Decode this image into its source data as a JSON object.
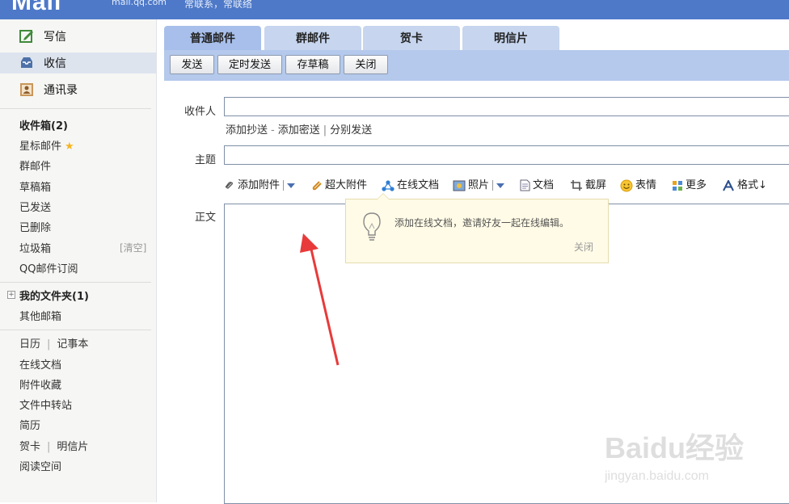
{
  "header": {
    "logo": "Mail",
    "domain": "mail.qq.com",
    "slogan": "常联系，常联络"
  },
  "sidebar": {
    "main_nav": [
      {
        "label": "写信",
        "icon": "compose-icon"
      },
      {
        "label": "收信",
        "icon": "inbox-icon"
      },
      {
        "label": "通讯录",
        "icon": "contacts-icon"
      }
    ],
    "folders": {
      "inbox": "收件箱(2)",
      "starred": "星标邮件",
      "group": "群邮件",
      "drafts": "草稿箱",
      "sent": "已发送",
      "deleted": "已删除",
      "trash": "垃圾箱",
      "trash_clear": "[清空]",
      "subscriptions": "QQ邮件订阅"
    },
    "my_folders": "我的文件夹(1)",
    "other_mailbox": "其他邮箱",
    "apps": {
      "calendar": "日历",
      "notepad": "记事本",
      "online_docs": "在线文档",
      "attachment_fav": "附件收藏",
      "file_transfer": "文件中转站",
      "resume": "简历",
      "greeting": "贺卡",
      "postcard": "明信片",
      "reading": "阅读空间",
      "separator": "|"
    }
  },
  "compose": {
    "tabs": [
      "普通邮件",
      "群邮件",
      "贺卡",
      "明信片"
    ],
    "toolbar": {
      "send": "发送",
      "scheduled_send": "定时发送",
      "save_draft": "存草稿",
      "close": "关闭"
    },
    "recipient_label": "收件人",
    "add_cc": "添加抄送",
    "add_bcc": "添加密送",
    "separate_send": "分别发送",
    "link_dash": "-",
    "link_pipe": "|",
    "subject_label": "主题",
    "attach_bar": {
      "attach": "添加附件",
      "big_attach": "超大附件",
      "online_doc": "在线文档",
      "photo": "照片",
      "document": "文档",
      "screenshot": "截屏",
      "emoji": "表情",
      "more": "更多",
      "format": "格式↓"
    },
    "body_label": "正文",
    "body_value": ""
  },
  "tooltip": {
    "message": "添加在线文档，邀请好友一起在线编辑。",
    "close": "关闭"
  },
  "watermark": {
    "brand": "Baidu经验",
    "url": "jingyan.baidu.com"
  },
  "colors": {
    "topbar": "#4e79c8",
    "toolbar": "#b4c9ec",
    "tab": "#c7d5ee",
    "arrow": "#e83a3a"
  }
}
